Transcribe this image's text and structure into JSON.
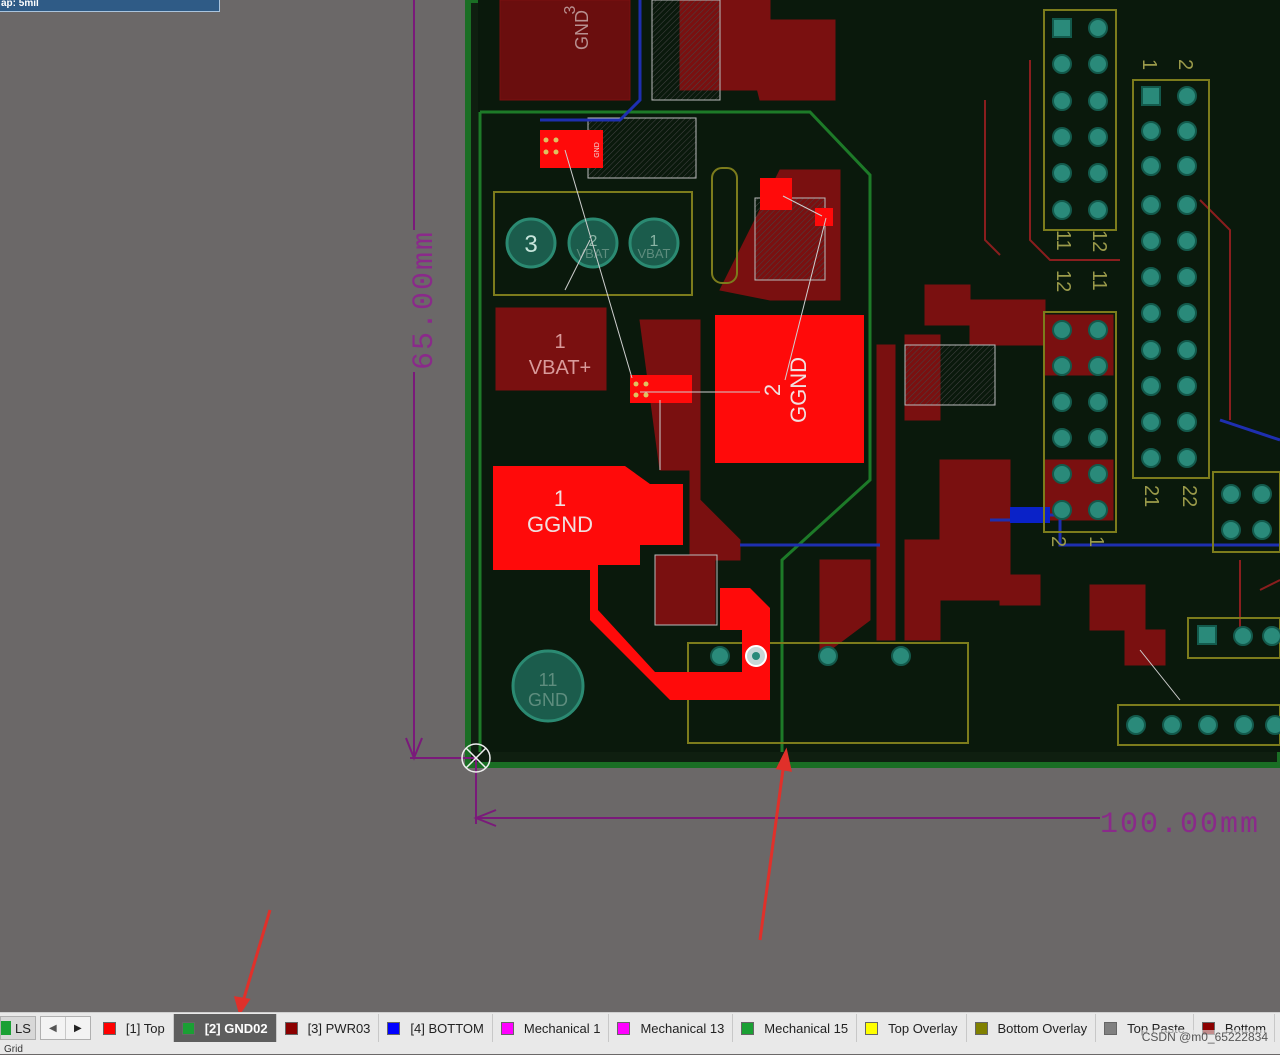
{
  "snap_label": "ap: 5mil",
  "dimensions": {
    "height_label": "65.00mm",
    "width_label": "100.00mm"
  },
  "components": {
    "batt_pins": [
      "3",
      "2",
      "1"
    ],
    "batt_pin_labels": [
      "",
      "VBAT",
      "VBAT"
    ],
    "vbat_pad_num": "1",
    "vbat_pad_net": "VBAT+",
    "ggnd_big_num": "2",
    "ggnd_big_net": "GGND",
    "ggnd_left_num": "1",
    "ggnd_left_net": "GGND",
    "gnd_pad_num": "11",
    "gnd_pad_net": "GND",
    "header_left_top": [
      "1",
      "2"
    ],
    "header_left_bottom": [
      "21",
      "22"
    ],
    "header_side_a": [
      "1",
      "2"
    ],
    "header_side_b": [
      "12",
      "11"
    ],
    "header_side_c": [
      "11",
      "12"
    ],
    "small_gnd_label": "GND",
    "small_top_num": "3",
    "small_top_net": "GND"
  },
  "layer_bar": {
    "ls_label": "LS",
    "tabs": [
      {
        "label": "[1] Top",
        "color": "#ff0000",
        "active": false
      },
      {
        "label": "[2] GND02",
        "color": "#1aa034",
        "active": true
      },
      {
        "label": "[3] PWR03",
        "color": "#8b0000",
        "active": false
      },
      {
        "label": "[4] BOTTOM",
        "color": "#0000ff",
        "active": false
      },
      {
        "label": "Mechanical 1",
        "color": "#ff00ff",
        "active": false
      },
      {
        "label": "Mechanical 13",
        "color": "#ff00ff",
        "active": false
      },
      {
        "label": "Mechanical 15",
        "color": "#1aa034",
        "active": false
      },
      {
        "label": "Top Overlay",
        "color": "#ffff00",
        "active": false
      },
      {
        "label": "Bottom Overlay",
        "color": "#808000",
        "active": false
      },
      {
        "label": "Top Paste",
        "color": "#808080",
        "active": false
      },
      {
        "label": "Bottom",
        "color": "#8b0000",
        "active": false
      }
    ]
  },
  "status_text": "Grid",
  "watermark": "CSDN @m0_65222834"
}
